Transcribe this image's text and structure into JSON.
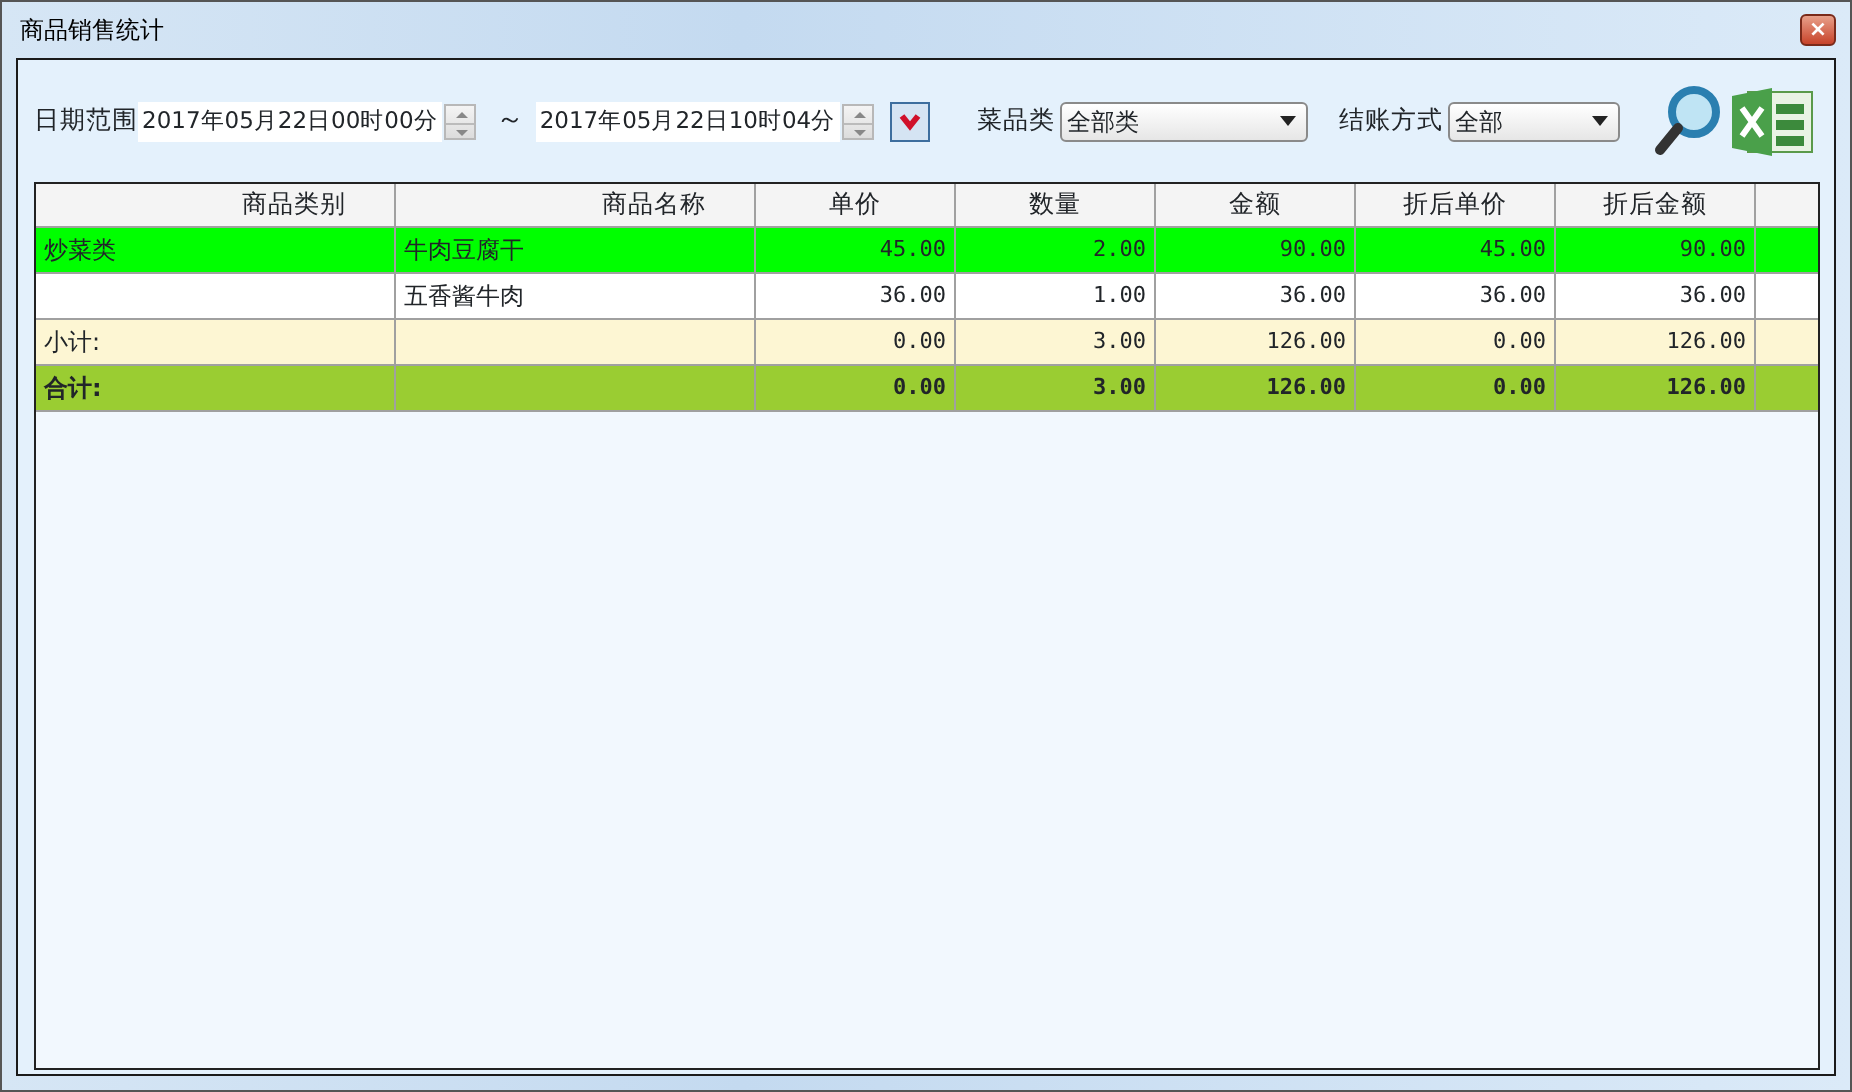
{
  "window": {
    "title": "商品销售统计",
    "close": "×"
  },
  "toolbar": {
    "date_label": "日期范围",
    "date_from": "2017年05月22日00时00分",
    "separator": "～",
    "date_to": "2017年05月22日10时04分",
    "category_label": "菜品类",
    "category_value": "全部类",
    "payment_label": "结账方式",
    "payment_value": "全部"
  },
  "table": {
    "columns": [
      "商品类别",
      "商品名称",
      "单价",
      "数量",
      "金额",
      "折后单价",
      "折后金额"
    ],
    "rows": [
      {
        "kind": "item",
        "selected": true,
        "cells": [
          "炒菜类",
          "牛肉豆腐干",
          "45.00",
          "2.00",
          "90.00",
          "45.00",
          "90.00"
        ]
      },
      {
        "kind": "item",
        "selected": false,
        "cells": [
          "",
          "五香酱牛肉",
          "36.00",
          "1.00",
          "36.00",
          "36.00",
          "36.00"
        ]
      },
      {
        "kind": "subtotal",
        "selected": false,
        "cells": [
          "小计:",
          "",
          "0.00",
          "3.00",
          "126.00",
          "0.00",
          "126.00"
        ]
      },
      {
        "kind": "total",
        "selected": false,
        "cells": [
          "合计:",
          "",
          "0.00",
          "3.00",
          "126.00",
          "0.00",
          "126.00"
        ]
      }
    ]
  }
}
